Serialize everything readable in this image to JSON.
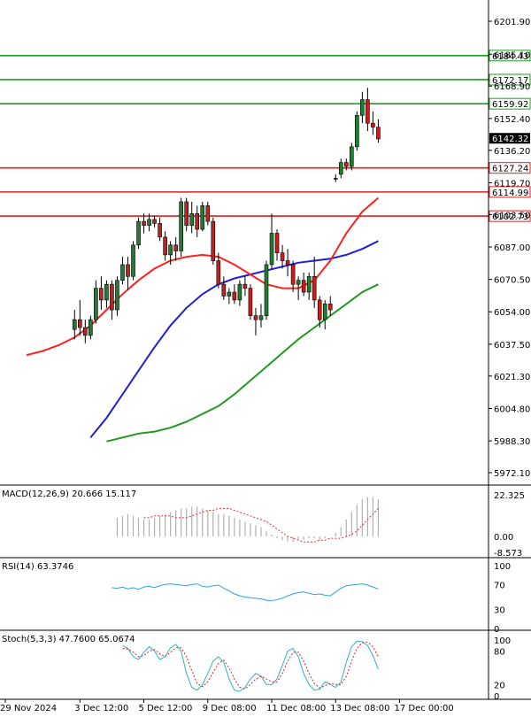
{
  "colors": {
    "bull": "#1e7d2e",
    "bear": "#c81e1e",
    "resistance": "#1e9e1e",
    "support": "#e01f1f",
    "ma_fast": "#ff2020",
    "ma_mid": "#1f1fd8",
    "ma_slow": "#1f9a1f",
    "macd_hist": "#b0b0b0",
    "macd_signal": "#e03030",
    "rsi": "#2ba3d6",
    "stoch_main": "#2bb3c6",
    "stoch_signal": "#e02020",
    "current_bg": "#000000"
  },
  "chart_data": [
    {
      "type": "candlestick",
      "title": "",
      "price_axis": {
        "ticks": [
          "6201.90",
          "6185.10",
          "6168.90",
          "6152.40",
          "6136.20",
          "6119.70",
          "6103.50",
          "6087.00",
          "6070.50",
          "6054.00",
          "6037.50",
          "6021.30",
          "6004.80",
          "5988.30",
          "5972.10"
        ],
        "ylim": [
          5967,
          6206
        ]
      },
      "time_axis": {
        "labels": [
          "29 Nov 2024",
          "3 Dec 12:00",
          "5 Dec 12:00",
          "9 Dec 08:00",
          "11 Dec 08:00",
          "13 Dec 08:00",
          "17 Dec 00:00"
        ],
        "label_bar_index": [
          1,
          15,
          27,
          39,
          51,
          63,
          75
        ]
      },
      "resistance_levels": [
        "6184.43",
        "6172.17",
        "6159.92"
      ],
      "support_levels": [
        "6127.24",
        "6114.99",
        "6102.73"
      ],
      "current_price": "6142.32",
      "candles": [
        {
          "o": 6045,
          "h": 6055,
          "l": 6040,
          "c": 6050
        },
        {
          "o": 6050,
          "h": 6060,
          "l": 6042,
          "c": 6046
        },
        {
          "o": 6046,
          "h": 6050,
          "l": 6038,
          "c": 6042
        },
        {
          "o": 6042,
          "h": 6052,
          "l": 6040,
          "c": 6050
        },
        {
          "o": 6050,
          "h": 6070,
          "l": 6048,
          "c": 6066
        },
        {
          "o": 6066,
          "h": 6072,
          "l": 6055,
          "c": 6060
        },
        {
          "o": 6060,
          "h": 6070,
          "l": 6056,
          "c": 6068
        },
        {
          "o": 6068,
          "h": 6070,
          "l": 6050,
          "c": 6055
        },
        {
          "o": 6055,
          "h": 6072,
          "l": 6052,
          "c": 6070
        },
        {
          "o": 6070,
          "h": 6082,
          "l": 6068,
          "c": 6078
        },
        {
          "o": 6078,
          "h": 6082,
          "l": 6065,
          "c": 6072
        },
        {
          "o": 6072,
          "h": 6090,
          "l": 6070,
          "c": 6088
        },
        {
          "o": 6088,
          "h": 6102,
          "l": 6086,
          "c": 6100
        },
        {
          "o": 6100,
          "h": 6104,
          "l": 6094,
          "c": 6098
        },
        {
          "o": 6098,
          "h": 6104,
          "l": 6095,
          "c": 6101
        },
        {
          "o": 6101,
          "h": 6103,
          "l": 6097,
          "c": 6099
        },
        {
          "o": 6099,
          "h": 6102,
          "l": 6090,
          "c": 6092
        },
        {
          "o": 6092,
          "h": 6095,
          "l": 6080,
          "c": 6083
        },
        {
          "o": 6083,
          "h": 6090,
          "l": 6078,
          "c": 6088
        },
        {
          "o": 6088,
          "h": 6092,
          "l": 6080,
          "c": 6085
        },
        {
          "o": 6085,
          "h": 6112,
          "l": 6082,
          "c": 6110
        },
        {
          "o": 6110,
          "h": 6112,
          "l": 6095,
          "c": 6098
        },
        {
          "o": 6098,
          "h": 6110,
          "l": 6094,
          "c": 6104
        },
        {
          "o": 6104,
          "h": 6108,
          "l": 6092,
          "c": 6096
        },
        {
          "o": 6096,
          "h": 6110,
          "l": 6095,
          "c": 6108
        },
        {
          "o": 6108,
          "h": 6110,
          "l": 6098,
          "c": 6100
        },
        {
          "o": 6100,
          "h": 6102,
          "l": 6078,
          "c": 6080
        },
        {
          "o": 6080,
          "h": 6084,
          "l": 6066,
          "c": 6068
        },
        {
          "o": 6068,
          "h": 6072,
          "l": 6060,
          "c": 6062
        },
        {
          "o": 6062,
          "h": 6066,
          "l": 6058,
          "c": 6064
        },
        {
          "o": 6064,
          "h": 6068,
          "l": 6058,
          "c": 6060
        },
        {
          "o": 6060,
          "h": 6070,
          "l": 6057,
          "c": 6068
        },
        {
          "o": 6068,
          "h": 6072,
          "l": 6062,
          "c": 6066
        },
        {
          "o": 6066,
          "h": 6068,
          "l": 6050,
          "c": 6052
        },
        {
          "o": 6052,
          "h": 6056,
          "l": 6042,
          "c": 6050
        },
        {
          "o": 6050,
          "h": 6058,
          "l": 6046,
          "c": 6052
        },
        {
          "o": 6052,
          "h": 6080,
          "l": 6050,
          "c": 6078
        },
        {
          "o": 6078,
          "h": 6104,
          "l": 6076,
          "c": 6094
        },
        {
          "o": 6094,
          "h": 6096,
          "l": 6080,
          "c": 6084
        },
        {
          "o": 6084,
          "h": 6088,
          "l": 6076,
          "c": 6080
        },
        {
          "o": 6080,
          "h": 6086,
          "l": 6072,
          "c": 6078
        },
        {
          "o": 6078,
          "h": 6080,
          "l": 6064,
          "c": 6068
        },
        {
          "o": 6068,
          "h": 6072,
          "l": 6060,
          "c": 6070
        },
        {
          "o": 6070,
          "h": 6074,
          "l": 6062,
          "c": 6064
        },
        {
          "o": 6064,
          "h": 6074,
          "l": 6060,
          "c": 6072
        },
        {
          "o": 6072,
          "h": 6082,
          "l": 6056,
          "c": 6060
        },
        {
          "o": 6060,
          "h": 6062,
          "l": 6046,
          "c": 6050
        },
        {
          "o": 6050,
          "h": 6060,
          "l": 6045,
          "c": 6058
        },
        {
          "o": 6058,
          "h": 6062,
          "l": 6052,
          "c": 6055
        },
        {
          "o": 6122,
          "h": 6124,
          "l": 6120,
          "c": 6122
        },
        {
          "o": 6124,
          "h": 6132,
          "l": 6122,
          "c": 6130
        },
        {
          "o": 6130,
          "h": 6132,
          "l": 6126,
          "c": 6128
        },
        {
          "o": 6128,
          "h": 6140,
          "l": 6126,
          "c": 6138
        },
        {
          "o": 6138,
          "h": 6156,
          "l": 6136,
          "c": 6154
        },
        {
          "o": 6154,
          "h": 6166,
          "l": 6150,
          "c": 6162
        },
        {
          "o": 6162,
          "h": 6168,
          "l": 6146,
          "c": 6150
        },
        {
          "o": 6150,
          "h": 6156,
          "l": 6144,
          "c": 6148
        },
        {
          "o": 6148,
          "h": 6152,
          "l": 6140,
          "c": 6142
        }
      ],
      "ma_fast": [
        6032,
        6034,
        6037,
        6041,
        6047,
        6055,
        6063,
        6070,
        6076,
        6080,
        6082,
        6083,
        6082,
        6078,
        6073,
        6068,
        6066,
        6066,
        6070,
        6080,
        6094,
        6105,
        6112
      ],
      "ma_mid": [
        5990,
        6000,
        6012,
        6024,
        6036,
        6047,
        6056,
        6063,
        6068,
        6071,
        6073,
        6075,
        6077,
        6079,
        6080,
        6081,
        6083,
        6086,
        6090
      ],
      "ma_slow": [
        5988,
        5990,
        5992,
        5993,
        5995,
        5998,
        6002,
        6006,
        6012,
        6019,
        6026,
        6033,
        6040,
        6046,
        6052,
        6058,
        6064,
        6068
      ]
    },
    {
      "type": "bar",
      "title": "MACD(12,26,9) 20.666 15.117",
      "axis_ticks": [
        "22.325",
        "0.00",
        "-8.573"
      ],
      "ylim": [
        -8.573,
        22.325
      ],
      "histogram": [
        10,
        11,
        12,
        11,
        10,
        9,
        9,
        10,
        11,
        12,
        13,
        14,
        15,
        15,
        16,
        16,
        15,
        14,
        13,
        12,
        12,
        11,
        10,
        9,
        8,
        7,
        6,
        5,
        3,
        1,
        -1,
        -2,
        -3,
        -3,
        -2,
        -2,
        -1,
        -1,
        -2,
        -1,
        0,
        2,
        5,
        9,
        13,
        17,
        20,
        21,
        21,
        20
      ],
      "signal": [
        10,
        10,
        11,
        11,
        11,
        11,
        10,
        10,
        10,
        11,
        12,
        13,
        14,
        14,
        15,
        15,
        15,
        14,
        13,
        12,
        11,
        10,
        9,
        8,
        6,
        4,
        2,
        0,
        -1,
        -2,
        -3,
        -3,
        -3,
        -2,
        -2,
        -1,
        -1,
        -1,
        0,
        1,
        3,
        6,
        9,
        12,
        15
      ]
    },
    {
      "type": "line",
      "title": "RSI(14) 63.3746",
      "axis_ticks": [
        "100",
        "70",
        "30",
        "0"
      ],
      "ylim": [
        0,
        100
      ],
      "values": [
        65,
        64,
        66,
        63,
        65,
        62,
        66,
        67,
        65,
        68,
        70,
        71,
        70,
        69,
        68,
        70,
        71,
        67,
        66,
        68,
        69,
        64,
        60,
        55,
        52,
        50,
        49,
        48,
        47,
        45,
        44,
        46,
        48,
        52,
        55,
        57,
        58,
        56,
        54,
        55,
        53,
        52,
        58,
        64,
        68,
        69,
        70,
        71,
        69,
        66,
        63
      ]
    },
    {
      "type": "line",
      "title": "Stoch(5,3,3) 47.7600 65.0674",
      "axis_ticks": [
        "100",
        "80",
        "20",
        "0"
      ],
      "ylim": [
        0,
        100
      ],
      "k": [
        90,
        85,
        70,
        65,
        78,
        88,
        80,
        65,
        70,
        86,
        92,
        80,
        40,
        15,
        10,
        20,
        40,
        62,
        70,
        60,
        30,
        10,
        8,
        15,
        30,
        40,
        35,
        20,
        20,
        30,
        55,
        80,
        85,
        70,
        40,
        20,
        10,
        12,
        25,
        20,
        15,
        25,
        60,
        88,
        98,
        97,
        90,
        72,
        48
      ],
      "d": [
        85,
        84,
        78,
        70,
        72,
        80,
        83,
        75,
        70,
        78,
        86,
        86,
        70,
        45,
        22,
        16,
        25,
        42,
        58,
        64,
        50,
        30,
        15,
        12,
        20,
        30,
        35,
        30,
        25,
        25,
        40,
        62,
        78,
        78,
        62,
        40,
        22,
        14,
        18,
        22,
        20,
        20,
        35,
        62,
        85,
        95,
        96,
        88,
        70
      ]
    }
  ]
}
